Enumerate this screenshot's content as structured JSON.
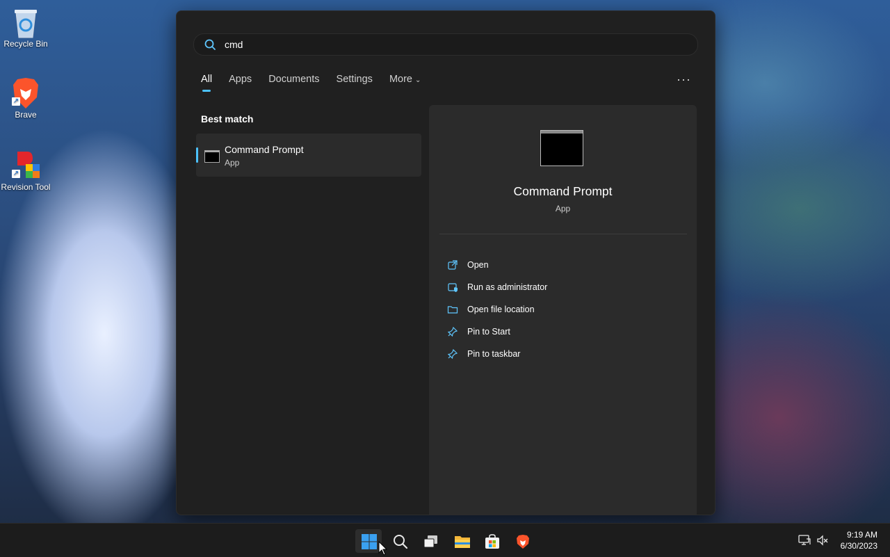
{
  "desktop": {
    "icons": [
      {
        "label": "Recycle Bin",
        "icon": "recycle-bin-icon"
      },
      {
        "label": "Brave",
        "icon": "brave-lion-icon"
      },
      {
        "label": "Revision Tool",
        "icon": "revision-tool-icon"
      }
    ]
  },
  "start_menu": {
    "search": {
      "value": "cmd",
      "icon": "search-icon"
    },
    "tabs": [
      {
        "label": "All",
        "active": true
      },
      {
        "label": "Apps"
      },
      {
        "label": "Documents"
      },
      {
        "label": "Settings"
      },
      {
        "label": "More"
      }
    ],
    "overflow_icon": "ellipsis-icon",
    "best_match_label": "Best match",
    "result": {
      "title": "Command Prompt",
      "subtitle": "App",
      "icon": "command-prompt-icon"
    },
    "detail": {
      "title": "Command Prompt",
      "subtitle": "App",
      "actions": [
        {
          "label": "Open",
          "icon": "open-external-icon"
        },
        {
          "label": "Run as administrator",
          "icon": "shield-admin-icon"
        },
        {
          "label": "Open file location",
          "icon": "folder-icon"
        },
        {
          "label": "Pin to Start",
          "icon": "pin-icon"
        },
        {
          "label": "Pin to taskbar",
          "icon": "pin-icon"
        }
      ]
    }
  },
  "taskbar": {
    "apps": [
      "windows-start-icon",
      "search-icon",
      "task-view-icon",
      "file-explorer-icon",
      "microsoft-store-icon",
      "brave-icon"
    ],
    "tray": [
      "network-icon",
      "volume-muted-icon"
    ],
    "time": "9:19 AM",
    "date": "6/30/2023"
  },
  "colors": {
    "accent": "#4cc2ff",
    "menu_bg": "#202020",
    "panel_bg": "#2b2b2b"
  }
}
